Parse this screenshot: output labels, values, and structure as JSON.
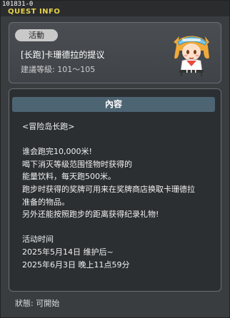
{
  "window": {
    "id_text": "101831-0",
    "title": "QUEST INFO"
  },
  "info": {
    "category": "活動",
    "quest_name": "[长跑]卡珊德拉的提议",
    "level_text": "建議等級: 101〜105",
    "npc_avatar": "girl-with-visor-npc"
  },
  "content": {
    "header": "內容",
    "lines": [
      "<冒险岛长跑>",
      "",
      "谁会跑完10,000米!",
      "喝下消灭等级范围怪物时获得的",
      "能量饮料，每天跑500米。",
      "跑步时获得的奖牌可用来在奖牌商店换取卡珊德拉",
      "准备的物品。",
      "另外还能按照跑步的距离获得纪录礼物!",
      "",
      "活动时间",
      "2025年5月14日  维护后~",
      "2025年6月3日  晚上11点59分"
    ]
  },
  "status": {
    "text": "狀態:  可開始"
  },
  "colors": {
    "title_yellow": "#e8d24a",
    "header_blue": "#4d6473",
    "panel_bg": "#2c2f32",
    "window_bg": "#3a3d40"
  }
}
